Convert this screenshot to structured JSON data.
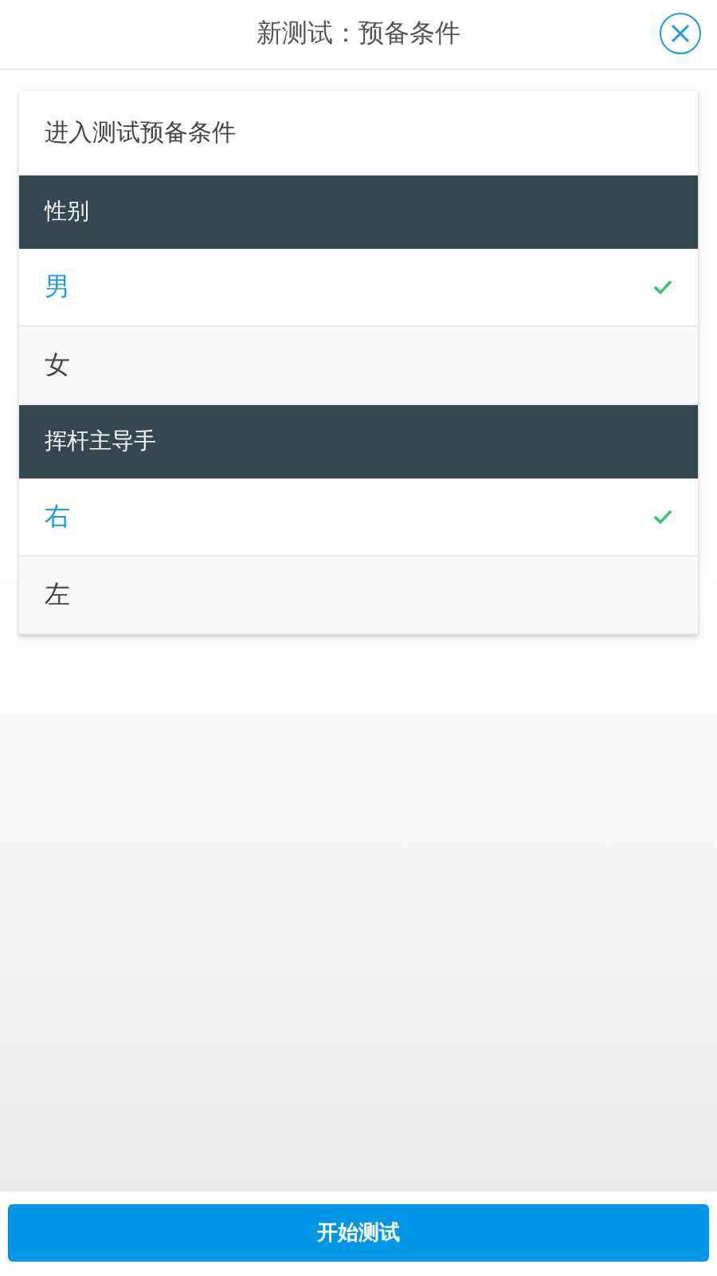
{
  "header": {
    "title": "新测试：预备条件"
  },
  "card": {
    "intro": "进入测试预备条件",
    "groups": [
      {
        "title": "性别",
        "options": [
          {
            "label": "男",
            "selected": true
          },
          {
            "label": "女",
            "selected": false
          }
        ]
      },
      {
        "title": "挥杆主导手",
        "options": [
          {
            "label": "右",
            "selected": true
          },
          {
            "label": "左",
            "selected": false
          }
        ]
      }
    ]
  },
  "footer": {
    "button": "开始测试"
  }
}
